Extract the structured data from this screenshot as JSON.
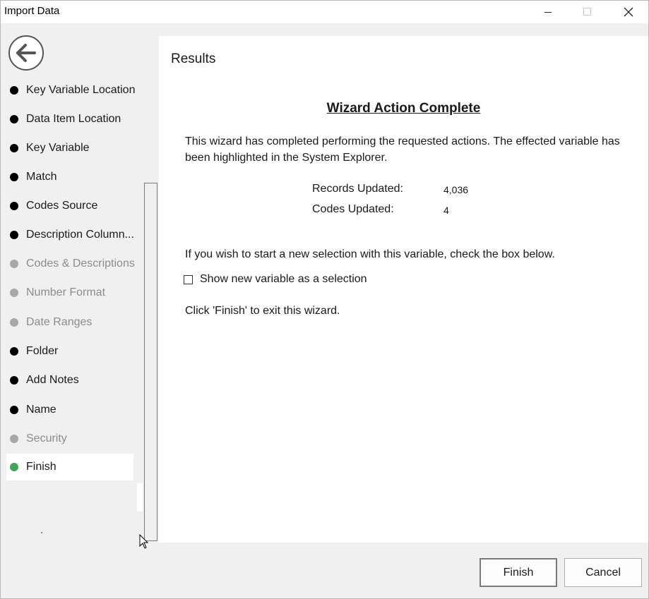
{
  "window": {
    "title": "Import Data"
  },
  "sidebar": {
    "items": [
      {
        "label": "Key Variable Location",
        "state": "done"
      },
      {
        "label": "Data Item Location",
        "state": "done"
      },
      {
        "label": "Key Variable",
        "state": "done"
      },
      {
        "label": "Match",
        "state": "done"
      },
      {
        "label": "Codes Source",
        "state": "done"
      },
      {
        "label": "Description  Column...",
        "state": "done"
      },
      {
        "label": "Codes & Descriptions",
        "state": "pending"
      },
      {
        "label": "Number Format",
        "state": "pending"
      },
      {
        "label": "Date Ranges",
        "state": "pending"
      },
      {
        "label": "Folder",
        "state": "done"
      },
      {
        "label": "Add Notes",
        "state": "done"
      },
      {
        "label": "Name",
        "state": "done"
      },
      {
        "label": "Security",
        "state": "pending"
      },
      {
        "label": "Finish",
        "state": "current"
      }
    ]
  },
  "content": {
    "section_title": "Results",
    "heading": "Wizard Action Complete",
    "description": "This wizard has completed performing the requested actions. The effected variable has been highlighted in the System Explorer.",
    "stats": {
      "records_label": "Records Updated:",
      "records_value": "4,036",
      "codes_label": "Codes Updated:",
      "codes_value": "4"
    },
    "selection_prompt": "If you wish to start a new selection with this variable, check the box below.",
    "checkbox_label": "Show new variable as a selection",
    "checkbox_checked": false,
    "finish_hint": "Click 'Finish' to exit this wizard."
  },
  "footer": {
    "finish_label": "Finish",
    "cancel_label": "Cancel"
  }
}
